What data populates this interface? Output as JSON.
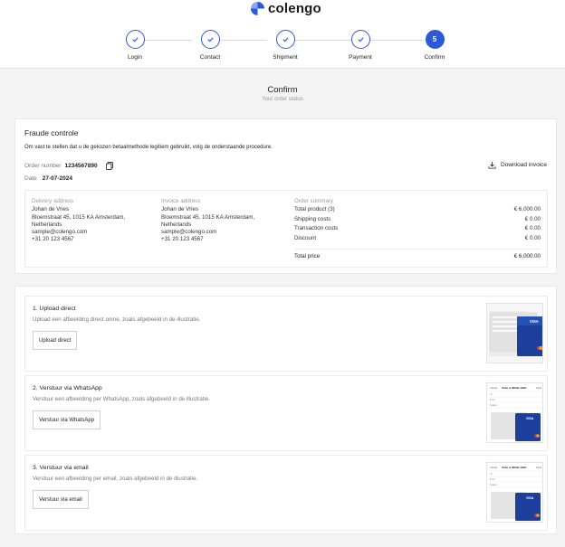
{
  "brand": {
    "name": "colengo",
    "color": "#2b59d9"
  },
  "stepper": {
    "steps": [
      {
        "label": "Login",
        "state": "done"
      },
      {
        "label": "Contact",
        "state": "done"
      },
      {
        "label": "Shipment",
        "state": "done"
      },
      {
        "label": "Payment",
        "state": "done"
      },
      {
        "label": "Confirm",
        "state": "active",
        "number": "5"
      }
    ]
  },
  "page": {
    "title": "Confirm",
    "subtitle": "Your order status"
  },
  "fraud": {
    "title": "Fraude controle",
    "description": "Om vast te stellen dat u de gekozen betaalmethode legitiem gebruikt, volg de onderstaande procedure.",
    "order_number_label": "Order number",
    "order_number": "1234567890",
    "date_label": "Date",
    "date": "27-07-2024",
    "download_label": "Download invoice"
  },
  "delivery": {
    "heading": "Delivery address",
    "lines": [
      "Johan de Vries",
      "Bloemstraat 45, 1015 KA Amsterdam,",
      "Netherlands",
      "sample@colengo.com",
      "+31 20 123 4567"
    ]
  },
  "invoice": {
    "heading": "Invoice address",
    "lines": [
      "Johan de Vries",
      "Bloemstraat 45, 1015 KA Amsterdam,",
      "Netherlands",
      "sample@colengo.com",
      "+31 20 123 4567"
    ]
  },
  "summary": {
    "heading": "Order summary",
    "rows": [
      {
        "label": "Total product (3)",
        "value": "€ 6,000.00"
      },
      {
        "label": "Shipping costs",
        "value": "€ 0.00"
      },
      {
        "label": "Transaction costs",
        "value": "€ 0.00"
      },
      {
        "label": "Discount",
        "value": "€ 0.00"
      }
    ],
    "total_label": "Total price",
    "total_value": "€ 6,000.00"
  },
  "methods": [
    {
      "title": "1. Upload direct",
      "description": "Upload een afbeelding direct onine, zoals afgebeeld in de illustratie.",
      "button": "Upload direct"
    },
    {
      "title": "2. Verstuur via WhatsApp",
      "description": "Verstuur een afbeelding per WhatsApp, zoals afgebeeld in de illustratie.",
      "button": "Verstuur via WhatsApp"
    },
    {
      "title": "3. Verstuur via email",
      "description": "Verstuur een afbeelding per email, zoals afgebeeld in de illustratie.",
      "button": "Verstuur via email"
    }
  ],
  "thumbs": {
    "card_brand": "VISA",
    "mock_cancel": "Cancel",
    "mock_title": "Order nr 083121 11821",
    "mock_send": "Send",
    "mock_to": "To:",
    "mock_from": "From:",
    "mock_subject": "Subject:"
  }
}
